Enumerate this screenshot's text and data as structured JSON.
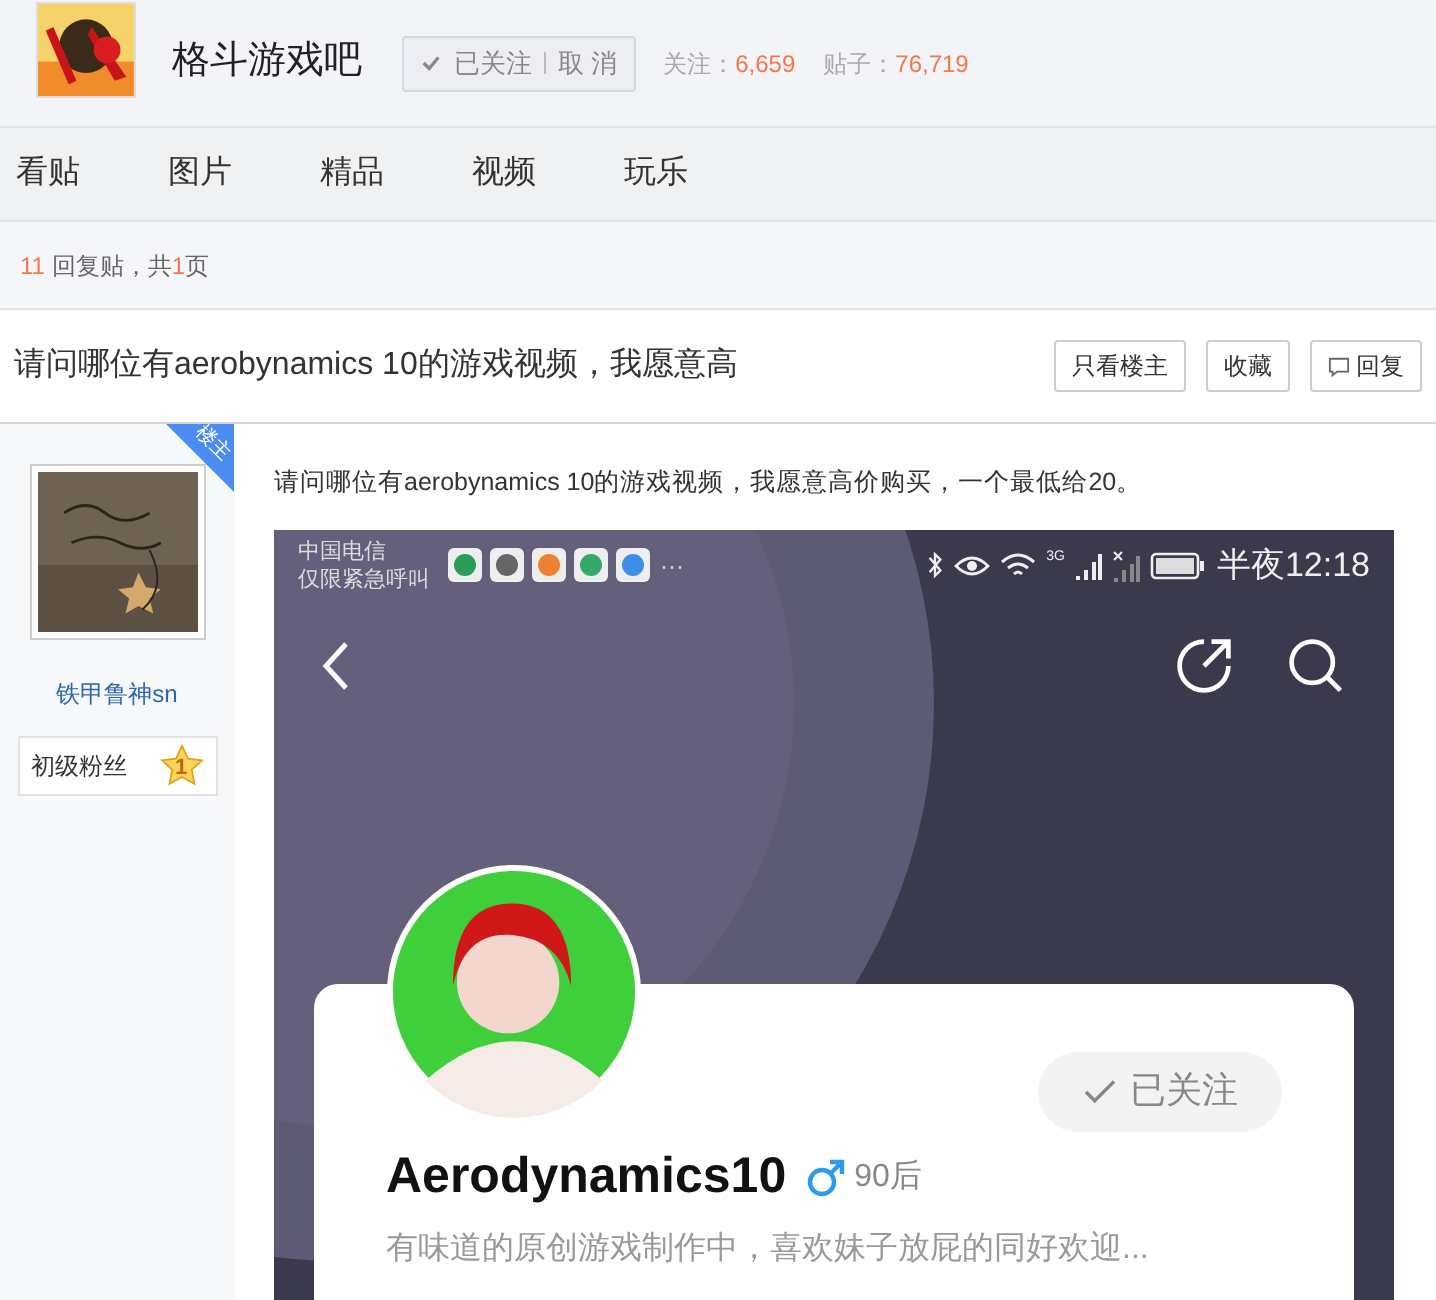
{
  "forum": {
    "name": "格斗游戏吧",
    "follow_button": {
      "label": "已关注",
      "cancel": "取 消",
      "followed": true
    },
    "stats": [
      {
        "label": "关注：",
        "value": "6,659"
      },
      {
        "label": "贴子：",
        "value": "76,719"
      }
    ]
  },
  "tabs": [
    {
      "label": "看贴",
      "selected": false
    },
    {
      "label": "图片",
      "selected": false
    },
    {
      "label": "精品",
      "selected": false
    },
    {
      "label": "视频",
      "selected": false
    },
    {
      "label": "玩乐",
      "selected": false
    }
  ],
  "pager": {
    "count": "11",
    "middle": " 回复贴，共",
    "pages": "1",
    "suffix": "页"
  },
  "thread": {
    "title": "请问哪位有aerobynamics 10的游戏视频，我愿意高",
    "actions": [
      {
        "label": "只看楼主",
        "kind": "plain"
      },
      {
        "label": "收藏",
        "kind": "plain"
      },
      {
        "label": "回复",
        "kind": "reply"
      }
    ]
  },
  "post": {
    "ribbon": "楼主",
    "author": {
      "name": "铁甲鲁神sn",
      "rank": "初级粉丝",
      "level": "1"
    },
    "text": "请问哪位有aerobynamics 10的游戏视频，我愿意高价购买，一个最低给20。",
    "phone": {
      "carrier": [
        "中国电信",
        "仅限紧急呼叫"
      ],
      "more": "···",
      "network": "3G",
      "time": "半夜12:18",
      "profile": {
        "follow": "已关注",
        "name": "Aerodynamics10",
        "age": "90后",
        "bio": "有味道的原创游戏制作中，喜欢妹子放屁的同好欢迎..."
      }
    }
  }
}
